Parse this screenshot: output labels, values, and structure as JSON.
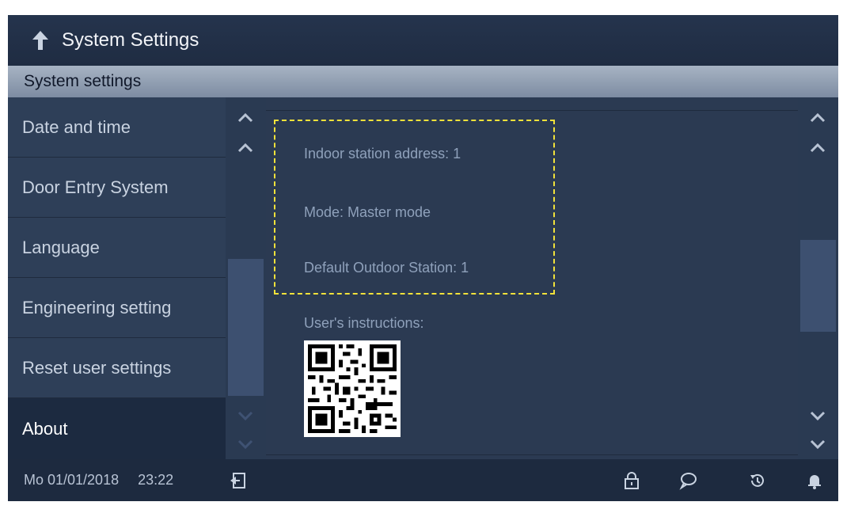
{
  "header": {
    "title": "System Settings"
  },
  "subheader": {
    "label": "System settings"
  },
  "menu": {
    "items": [
      {
        "label": "Date and time"
      },
      {
        "label": "Door Entry System"
      },
      {
        "label": "Language"
      },
      {
        "label": "Engineering setting"
      },
      {
        "label": "Reset user settings"
      },
      {
        "label": "About",
        "active": true
      }
    ]
  },
  "about": {
    "address": "Indoor station address: 1",
    "mode": "Mode: Master mode",
    "outdoor": "Default Outdoor Station: 1",
    "instructions": "User's instructions:"
  },
  "status": {
    "date": "Mo 01/01/2018",
    "time": "23:22"
  },
  "colors": {
    "background": "#2b3a52",
    "accent_highlight": "#f2e23a"
  },
  "icons": [
    "back-arrow-icon",
    "chevron-up-icon",
    "chevron-down-icon",
    "qr-code",
    "exit-icon",
    "lock-icon",
    "message-icon",
    "history-icon",
    "bell-icon"
  ]
}
